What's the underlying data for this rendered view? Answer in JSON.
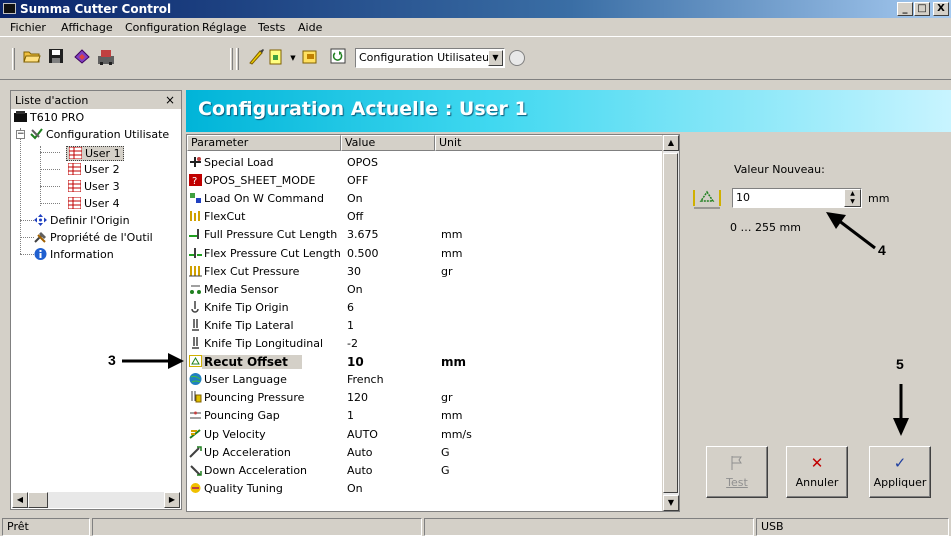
{
  "window": {
    "title": "Summa Cutter Control",
    "minimize": "_",
    "maximize": "□",
    "close": "X"
  },
  "menu": {
    "items": [
      "Fichier",
      "Affichage",
      "Configuration",
      "Réglage",
      "Tests",
      "Aide"
    ]
  },
  "toolbar": {
    "config_select": "Configuration Utilisateur"
  },
  "left_panel": {
    "title": "Liste d'action",
    "close": "×",
    "tree": {
      "root": "T610 PRO",
      "config": "Configuration Utilisate",
      "users": [
        "User 1",
        "User 2",
        "User 3",
        "User 4"
      ],
      "origin": "Definir l'Origin",
      "tool": "Propriété de l'Outil",
      "info": "Information"
    }
  },
  "header": {
    "title": "Configuration Actuelle : User 1"
  },
  "grid": {
    "columns": [
      "Parameter",
      "Value",
      "Unit"
    ],
    "rows": [
      {
        "name": "Special Load",
        "value": "OPOS",
        "unit": ""
      },
      {
        "name": "OPOS_SHEET_MODE",
        "value": "OFF",
        "unit": ""
      },
      {
        "name": "Load On W Command",
        "value": "On",
        "unit": ""
      },
      {
        "name": "FlexCut",
        "value": "Off",
        "unit": ""
      },
      {
        "name": "Full Pressure Cut Length",
        "value": "3.675",
        "unit": "mm"
      },
      {
        "name": "Flex Pressure Cut Length",
        "value": "0.500",
        "unit": "mm"
      },
      {
        "name": "Flex Cut Pressure",
        "value": "30",
        "unit": "gr"
      },
      {
        "name": "Media Sensor",
        "value": "On",
        "unit": ""
      },
      {
        "name": "Knife Tip Origin",
        "value": "6",
        "unit": ""
      },
      {
        "name": "Knife Tip Lateral",
        "value": "1",
        "unit": ""
      },
      {
        "name": "Knife Tip Longitudinal",
        "value": "-2",
        "unit": ""
      },
      {
        "name": "Recut Offset",
        "value": "10",
        "unit": "mm"
      },
      {
        "name": "User Language",
        "value": "French",
        "unit": ""
      },
      {
        "name": "Pouncing Pressure",
        "value": "120",
        "unit": "gr"
      },
      {
        "name": "Pouncing Gap",
        "value": "1",
        "unit": "mm"
      },
      {
        "name": "Up Velocity",
        "value": "AUTO",
        "unit": "mm/s"
      },
      {
        "name": "Up Acceleration",
        "value": "Auto",
        "unit": "G"
      },
      {
        "name": "Down Acceleration",
        "value": "Auto",
        "unit": "G"
      },
      {
        "name": "Quality Tuning",
        "value": "On",
        "unit": ""
      }
    ],
    "selected_index": 11
  },
  "editor": {
    "label": "Valeur Nouveau:",
    "value": "10",
    "unit": "mm",
    "range": "0 … 255 mm"
  },
  "buttons": {
    "test": "Test",
    "annuler": "Annuler",
    "appliquer": "Appliquer"
  },
  "annotations": {
    "n3": "3",
    "n4": "4",
    "n5": "5"
  },
  "status": {
    "left": "Prêt",
    "right": "USB"
  }
}
